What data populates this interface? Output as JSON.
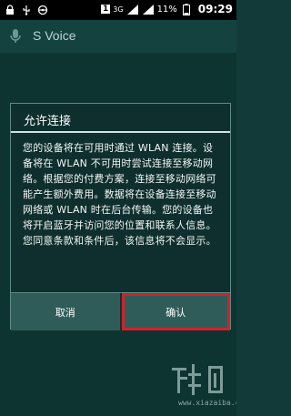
{
  "status_bar": {
    "sim_badge": "1",
    "network": "3G",
    "battery_percent": "11%",
    "time": "09:29"
  },
  "app": {
    "title": "S Voice",
    "icon": "microphone-icon"
  },
  "dialog": {
    "title": "允许连接",
    "message": "您的设备将在可用时通过 WLAN 连接。设备将在 WLAN 不可用时尝试连接至移动网络。根据您的付费方案，连接至移动网络可能产生额外费用。数据将在设备连接至移动网络或 WLAN 时在后台传输。您的设备也将开启蓝牙并访问您的位置和联系人信息。您同意条款和条件后，该信息将不会显示。",
    "cancel_label": "取消",
    "confirm_label": "确认"
  },
  "watermark": {
    "text": "www.xiazaiba.com"
  },
  "colors": {
    "highlight": "#d2212b",
    "dialog_bg": "#0e2f2d",
    "button_bg": "#2f5c59"
  }
}
